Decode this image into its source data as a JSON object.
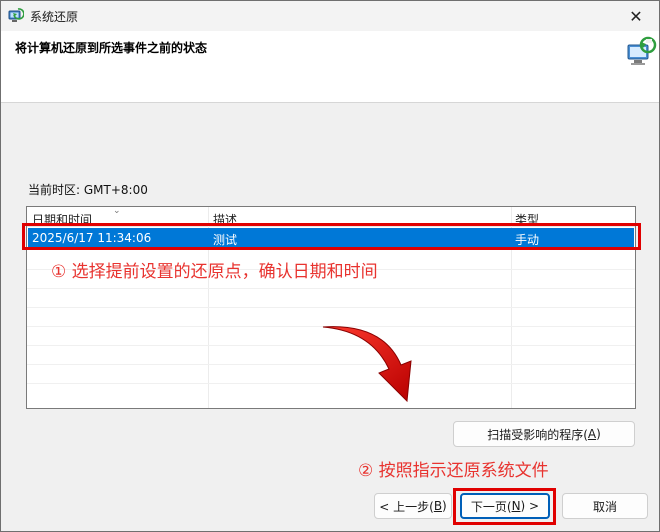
{
  "window": {
    "title": "系统还原",
    "close_glyph": "✕"
  },
  "header": {
    "heading": "将计算机还原到所选事件之前的状态"
  },
  "timezone": "当前时区: GMT+8:00",
  "table": {
    "columns": [
      "日期和时间",
      "描述",
      "类型"
    ],
    "rows": [
      {
        "datetime": "2025/6/17 11:34:06",
        "description": "测试",
        "type": "手动"
      }
    ]
  },
  "annotations": {
    "step1": "① 选择提前设置的还原点，确认日期和时间",
    "step2": "② 按照指示还原系统文件",
    "color": "#e8332f",
    "box_color": "#e00000"
  },
  "buttons": {
    "scan": {
      "text": "扫描受影响的程序(",
      "key": "A",
      "end": ")"
    },
    "back": {
      "text": "< 上一步(",
      "key": "B",
      "end": ")"
    },
    "next": {
      "text": "下一页(",
      "key": "N",
      "end": ") >"
    },
    "cancel": "取消"
  },
  "icons": {
    "app": "system-restore-icon",
    "wizard": "restore-wizard-icon",
    "close": "close-icon"
  },
  "colors": {
    "selection": "#0078d7",
    "accent_border": "#005fb8"
  }
}
